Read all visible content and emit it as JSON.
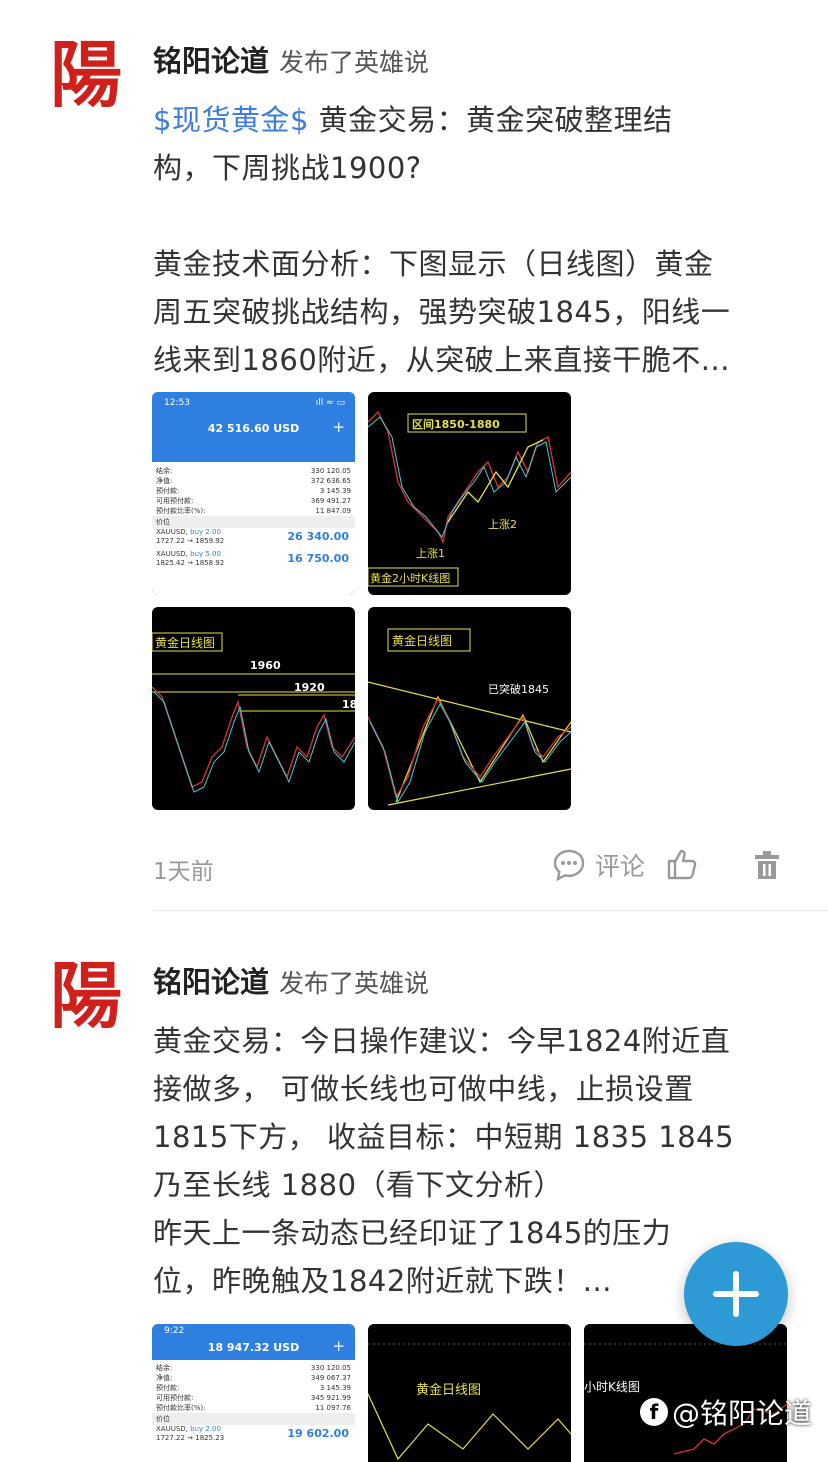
{
  "posts": [
    {
      "avatar_char": "陽",
      "author": "铭阳论道",
      "action": "发布了英雄说",
      "tag": "$现货黄金$",
      "text_lines": [
        " 黄金交易：黄金突破整理结",
        "构，下周挑战1900?",
        "",
        "黄金技术面分析：下图显示（日线图）黄金",
        "周五突破挑战结构，强势突破1845，阳线一",
        "线来到1860附近，从突破上来直接干脆不..."
      ],
      "images": {
        "account": {
          "time": "12:53",
          "signal": "ıll ≈ ▭",
          "balance": "42 516.60 USD",
          "plus": "+",
          "rows": [
            {
              "label": "结余:",
              "value": "330 120.05"
            },
            {
              "label": "净值:",
              "value": "372 636.65"
            },
            {
              "label": "预付款:",
              "value": "3 145.39"
            },
            {
              "label": "可用预付款:",
              "value": "369 491.27"
            },
            {
              "label": "预付款比率(%):",
              "value": "11 847.09"
            }
          ],
          "section": "价位",
          "positions": [
            {
              "sym": "XAUUSD,",
              "side": "buy 2.00",
              "range": "1727.22 → 1859.92",
              "pl": "26 340.00"
            },
            {
              "sym": "XAUUSD,",
              "side": "buy 5.00",
              "range": "1825.42 → 1858.92",
              "pl": "16 750.00"
            }
          ]
        },
        "chart1_labels": [
          "区间1850-1880",
          "上涨2",
          "上涨1",
          "黄金2小时K线图"
        ],
        "chart2_labels": [
          "黄金日线图",
          "1960",
          "1920",
          "18"
        ],
        "chart3_labels": [
          "黄金日线图",
          "已突破1845"
        ]
      },
      "time_ago": "1天前",
      "comment_label": "评论"
    },
    {
      "avatar_char": "陽",
      "author": "铭阳论道",
      "action": "发布了英雄说",
      "text_lines": [
        "黄金交易：今日操作建议：今早1824附近直",
        "接做多，  可做长线也可做中线，止损设置",
        "1815下方，  收益目标：中短期 1835   1845",
        "乃至长线 1880（看下文分析）",
        "昨天上一条动态已经印证了1845的压力",
        "位，昨晚触及1842附近就下跌！..."
      ],
      "images": {
        "account": {
          "time": "9:22",
          "balance": "18 947.32 USD",
          "plus": "+",
          "rows": [
            {
              "label": "结余:",
              "value": "330 120.05"
            },
            {
              "label": "净值:",
              "value": "349 067.37"
            },
            {
              "label": "预付款:",
              "value": "3 145.39"
            },
            {
              "label": "可用预付款:",
              "value": "345 921.99"
            },
            {
              "label": "预付款比率(%):",
              "value": "11 097.76"
            }
          ],
          "section": "价位",
          "positions": [
            {
              "sym": "XAUUSD,",
              "side": "buy 2.00",
              "range": "1727.22 → 1825.23",
              "pl": "19 602.00"
            }
          ]
        },
        "chart1_labels": [
          "黄金日线图"
        ],
        "chart2_labels": [
          "小时K线图"
        ]
      }
    }
  ],
  "fab_icon": "plus-icon",
  "watermark": "@铭阳论道",
  "colors": {
    "link": "#3b7de0",
    "avatar_red": "#d0201c",
    "fab": "#2d9ad6",
    "chart_yellow": "#e8e04a"
  }
}
